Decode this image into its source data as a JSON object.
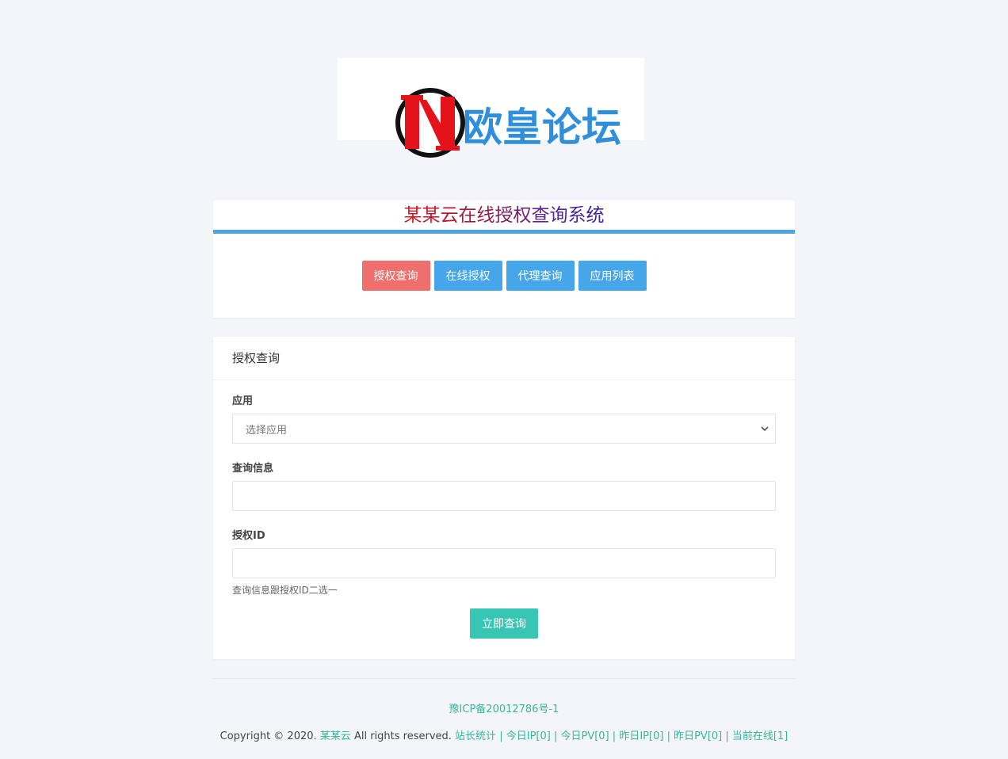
{
  "logo": {
    "alt": "HN 欧皇论坛",
    "text": "欧皇论坛",
    "colors": {
      "red": "#e4131b",
      "blue": "#2f8fdb",
      "ring": "#111111"
    }
  },
  "header": {
    "title": "某某云在线授权查询系统",
    "accent_color": "#4ea3e0"
  },
  "nav": {
    "buttons": [
      {
        "label": "授权查询",
        "color": "#ef6f6c"
      },
      {
        "label": "在线授权",
        "color": "#46a6ea"
      },
      {
        "label": "代理查询",
        "color": "#46a6ea"
      },
      {
        "label": "应用列表",
        "color": "#46a6ea"
      }
    ]
  },
  "form": {
    "heading": "授权查询",
    "app_label": "应用",
    "app_placeholder": "选择应用",
    "query_label": "查询信息",
    "query_value": "",
    "auth_id_label": "授权ID",
    "auth_id_value": "",
    "hint": "查询信息跟授权ID二选一",
    "submit_label": "立即查询"
  },
  "footer": {
    "icp": "豫ICP备20012786号-1",
    "copyright_prefix": "Copyright © 2020.",
    "site_name": "某某云",
    "rights": "All rights reserved.",
    "stats": "站长统计",
    "today_ip": "今日IP[0]",
    "today_pv": "今日PV[0]",
    "yesterday_ip": "昨日IP[0]",
    "yesterday_pv": "昨日PV[0]",
    "online": "当前在线[1]",
    "separator": "|"
  }
}
